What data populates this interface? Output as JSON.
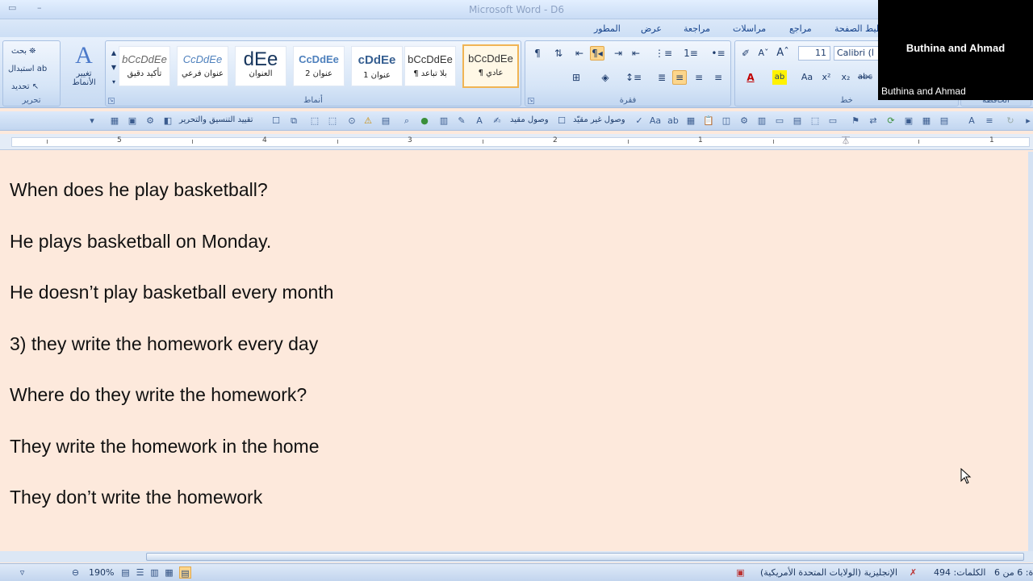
{
  "window": {
    "title": "Microsoft Word - D6"
  },
  "ribbon_tabs": [
    {
      "label": "المطور"
    },
    {
      "label": "عرض"
    },
    {
      "label": "مراجعة"
    },
    {
      "label": "مراسلات"
    },
    {
      "label": "مراجع"
    },
    {
      "label": "تخطيط الصفحة"
    }
  ],
  "editing_group": {
    "label": "تحرير",
    "find": "بحث",
    "replace": "استبدال",
    "select": "تحديد",
    "change_styles": "تغيير",
    "change_styles_2": "الأنماط"
  },
  "styles_group": {
    "label": "أنماط",
    "styles": [
      {
        "sample": "bCcDdEe",
        "name": "تأكيد دقيق"
      },
      {
        "sample": "CcDdEe",
        "name": "عنوان فرعي"
      },
      {
        "sample": "dEe",
        "name": "العنوان"
      },
      {
        "sample": "CcDdEe",
        "name": "عنوان 2"
      },
      {
        "sample": "cDdEe",
        "name": "عنوان 1"
      },
      {
        "sample": "bCcDdEe",
        "name": "¶ بلا تباعد"
      },
      {
        "sample": "bCcDdEe",
        "name": "¶ عادي",
        "selected": true
      }
    ]
  },
  "paragraph_group": {
    "label": "فقرة"
  },
  "font_group": {
    "label": "خط",
    "font_name": "Calibri (ا",
    "font_size": "11"
  },
  "clipboard_group": {
    "label": "الحافظة"
  },
  "toolbar": {
    "track_changes": "تقييد التنسيق والتحرير",
    "linked": "وصول مقيد",
    "unlinked": "وصول غير مقيّد"
  },
  "ruler": {
    "numbers": [
      "5",
      "4",
      "3",
      "2",
      "1",
      "1"
    ]
  },
  "document": {
    "lines": [
      "When does he play basketball?",
      "He plays basketball on Monday.",
      "He doesn’t play basketball every month",
      "3) they write the homework every day",
      "Where do they write the homework?",
      "They write the homework in the home",
      "They don’t write the homework"
    ]
  },
  "statusbar": {
    "zoom": "190%",
    "language": "الإنجليزية (الولايات المتحدة الأمريكية)",
    "words": "الكلمات: 494",
    "page": "ة: 6 من 6"
  },
  "webcam": {
    "name_large": "Buthina and Ahmad",
    "name_small": "Buthina and Ahmad"
  }
}
